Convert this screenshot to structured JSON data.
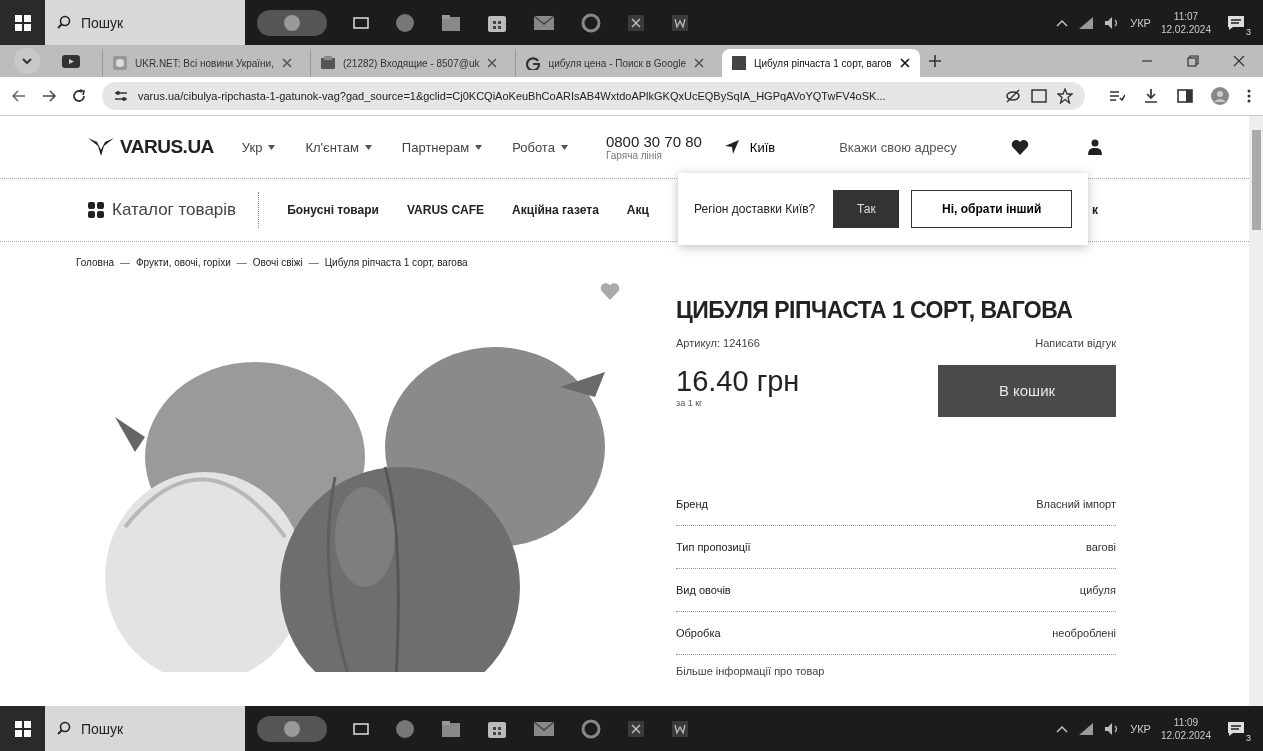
{
  "taskbar_top": {
    "search_placeholder": "Пошук",
    "tray": {
      "language": "УКР",
      "time": "11:07",
      "date": "12.02.2024",
      "notifications": "3"
    }
  },
  "browser": {
    "tabs": [
      {
        "kind": "ukrnet",
        "title": "UKR.NET: Всі новини України,",
        "selected": false
      },
      {
        "kind": "mail",
        "title": "(21282) Входящие - 8507@uk",
        "selected": false
      },
      {
        "kind": "google",
        "title": "цибуля цена - Поиск в Google",
        "selected": false
      },
      {
        "kind": "site",
        "title": "Цибуля ріпчаста 1 сорт, вагов",
        "selected": true
      }
    ],
    "url": "varus.ua/cibulya-ripchasta-1-gatunok-vag?gad_source=1&gclid=Cj0KCQiAoKeuBhCoARIsAB4WxtdoAPlkGKQxUcEQBySqIA_HGPqAVoYQTwFV4oSK..."
  },
  "page": {
    "header": {
      "logo": "VARUS.UA",
      "menus": [
        "Укр",
        "Кл'єнтам",
        "Партнерам",
        "Робота"
      ],
      "phone": "0800 30 70 80",
      "phone_caption": "Гаряча лінія",
      "city": "Київ",
      "address_placeholder": "Вкажи свою адресу"
    },
    "nav": {
      "catalog": "Каталог товарів",
      "items": [
        "Бонусні товари",
        "VARUS CAFE",
        "Акційна газета",
        "Акц",
        "к"
      ]
    },
    "region_popup": {
      "question": "Регіон доставки Київ?",
      "confirm": "Так",
      "other": "Ні, обрати інший"
    },
    "breadcrumbs": {
      "separator": "—",
      "items": [
        "Головна",
        "Фрукти, овочі, горіхи",
        "Овочі свіжі",
        "Цибуля ріпчаста 1 сорт, вагова"
      ]
    },
    "product": {
      "title": "ЦИБУЛЯ РІПЧАСТА 1 СОРТ, ВАГОВА",
      "sku": "Артикул: 124166",
      "review_link": "Написати відгук",
      "price": "16.40 грн",
      "unit": "за 1 кг",
      "cart_button": "В кошик",
      "specs": [
        {
          "label": "Бренд",
          "value": "Власний імпорт"
        },
        {
          "label": "Тип пропозиції",
          "value": "вагові"
        },
        {
          "label": "Вид овочів",
          "value": "цибуля"
        },
        {
          "label": "Обробка",
          "value": "необроблені"
        }
      ],
      "more_link": "Більше інформації про товар"
    }
  },
  "taskbar_bottom": {
    "search_placeholder": "Пошук",
    "tray": {
      "language": "УКР",
      "time": "11:09",
      "date": "12.02.2024",
      "notifications": "3"
    }
  }
}
